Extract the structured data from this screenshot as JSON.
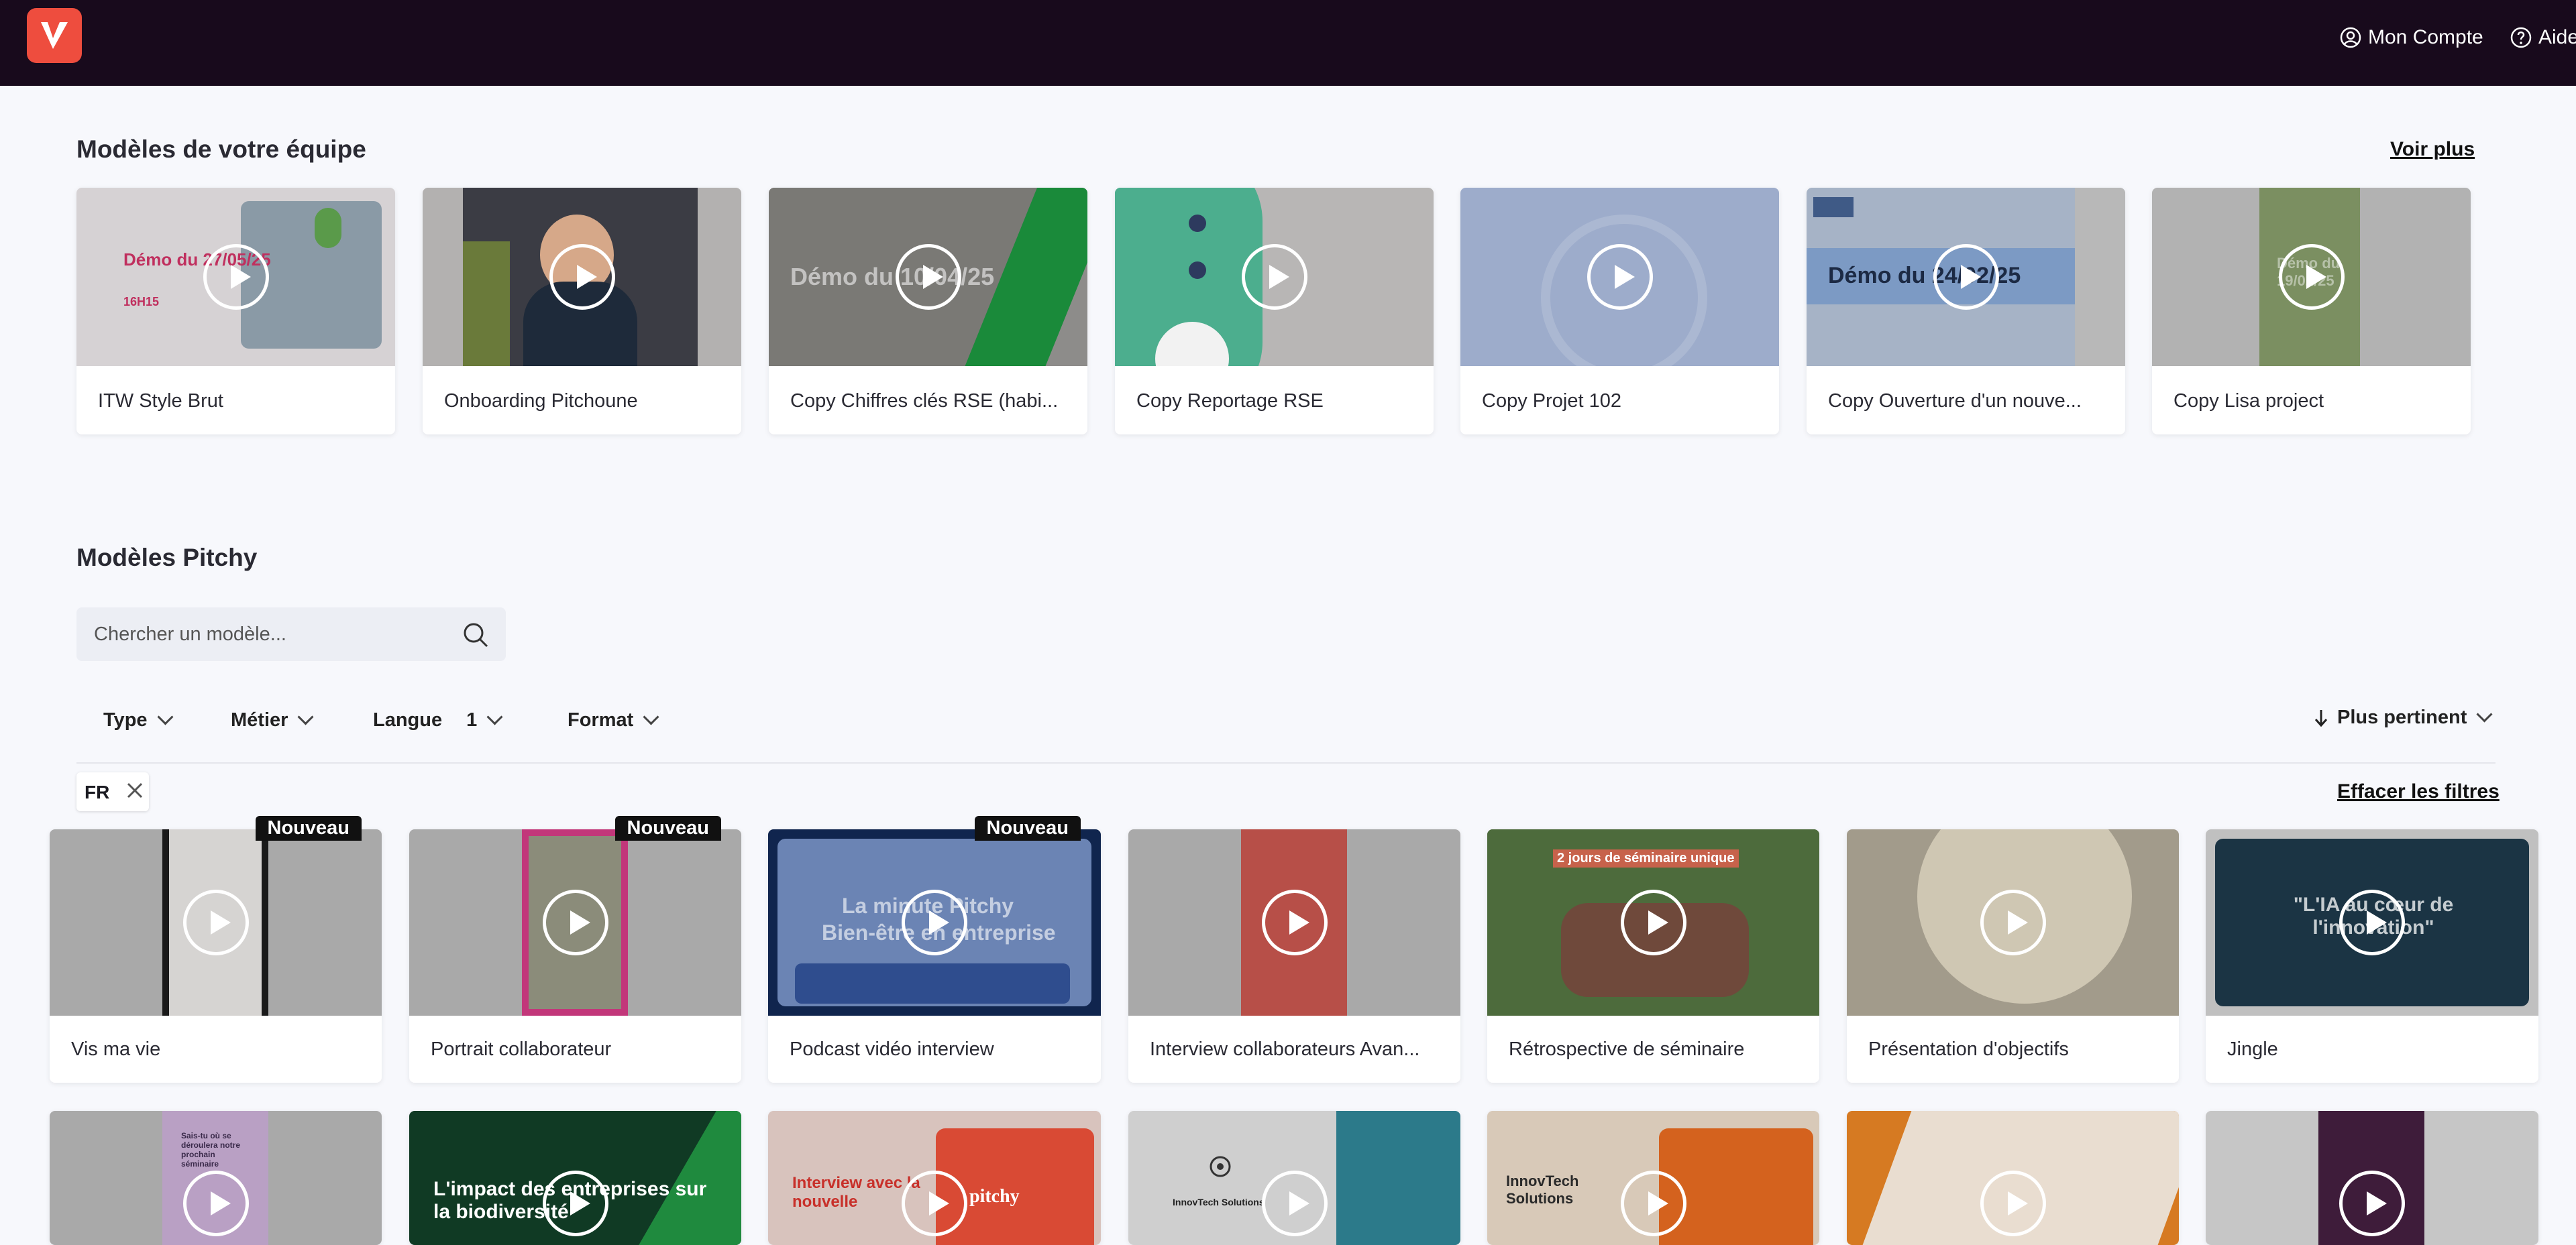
{
  "header": {
    "logo": "Pitchy",
    "account_label": "Mon Compte",
    "help_label": "Aide"
  },
  "team_section": {
    "title": "Modèles de votre équipe",
    "see_more": "Voir plus",
    "cards": [
      {
        "title": "ITW Style Brut",
        "thumb_text": "Démo du 27/05/25",
        "thumb_sub": "16H15"
      },
      {
        "title": "Onboarding Pitchoune"
      },
      {
        "title": "Copy Chiffres clés RSE (habi...",
        "thumb_text": "Démo du 10/04/25"
      },
      {
        "title": "Copy Reportage RSE"
      },
      {
        "title": "Copy Projet 102"
      },
      {
        "title": "Copy Ouverture d'un nouve...",
        "thumb_text": "Démo du 24/02/25"
      },
      {
        "title": "Copy Lisa project",
        "thumb_text": "Démo du 19/02/25"
      }
    ]
  },
  "pitchy_section": {
    "title": "Modèles Pitchy",
    "search_placeholder": "Chercher un modèle...",
    "filters": {
      "type": "Type",
      "metier": "Métier",
      "langue": "Langue",
      "langue_count": "1",
      "format": "Format"
    },
    "sort_label": "Plus pertinent",
    "active_filter": "FR",
    "clear_filters": "Effacer les filtres",
    "new_badge": "Nouveau",
    "cards": [
      {
        "title": "Vis ma vie",
        "new": true
      },
      {
        "title": "Portrait collaborateur",
        "new": true
      },
      {
        "title": "Podcast vidéo interview",
        "new": true,
        "thumb_text": "La minute Pitchy",
        "thumb_text2": "Bien-être en entreprise"
      },
      {
        "title": "Interview collaborateurs Avan..."
      },
      {
        "title": "Rétrospective de séminaire",
        "thumb_text": "2 jours de séminaire unique"
      },
      {
        "title": "Présentation d'objectifs"
      },
      {
        "title": "Jingle",
        "thumb_text": "\"L'IA au cœur de l'innovation\""
      }
    ],
    "row3": [
      {
        "thumb_text": "Sais-tu où se déroulera notre prochain séminaire"
      },
      {
        "thumb_text": "L'impact des entreprises sur la biodiversité"
      },
      {
        "thumb_text": "Interview avec la nouvelle",
        "thumb_text2": "pitchy"
      },
      {
        "thumb_text": "InnovTech Solutions"
      },
      {
        "thumb_text": "InnovTech Solutions"
      },
      {},
      {}
    ]
  }
}
